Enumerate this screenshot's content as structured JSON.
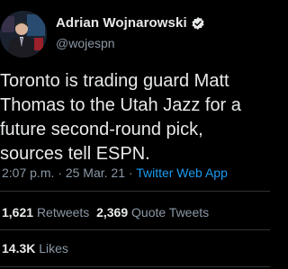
{
  "author": {
    "display_name": "Adrian Wojnarowski",
    "handle": "@wojespn",
    "verified_icon": "verified-badge-icon"
  },
  "tweet": {
    "text": "Toronto is trading guard Matt Thomas to the Utah Jazz for a future second-round pick, sources tell ESPN."
  },
  "meta": {
    "time": "2:07 p.m.",
    "separator1": " · ",
    "date": "25 Mar. 21",
    "separator2": " · ",
    "source": "Twitter Web App"
  },
  "stats": {
    "retweets_count": "1,621",
    "retweets_label": "Retweets",
    "quote_count": "2,369",
    "quote_label": "Quote Tweets",
    "likes_count": "14.3K",
    "likes_label": "Likes"
  },
  "colors": {
    "background": "#000000",
    "primary_text": "#e7e9ea",
    "secondary_text": "#8b98a5",
    "link": "#1d9bf0",
    "divider": "#2f3336"
  }
}
